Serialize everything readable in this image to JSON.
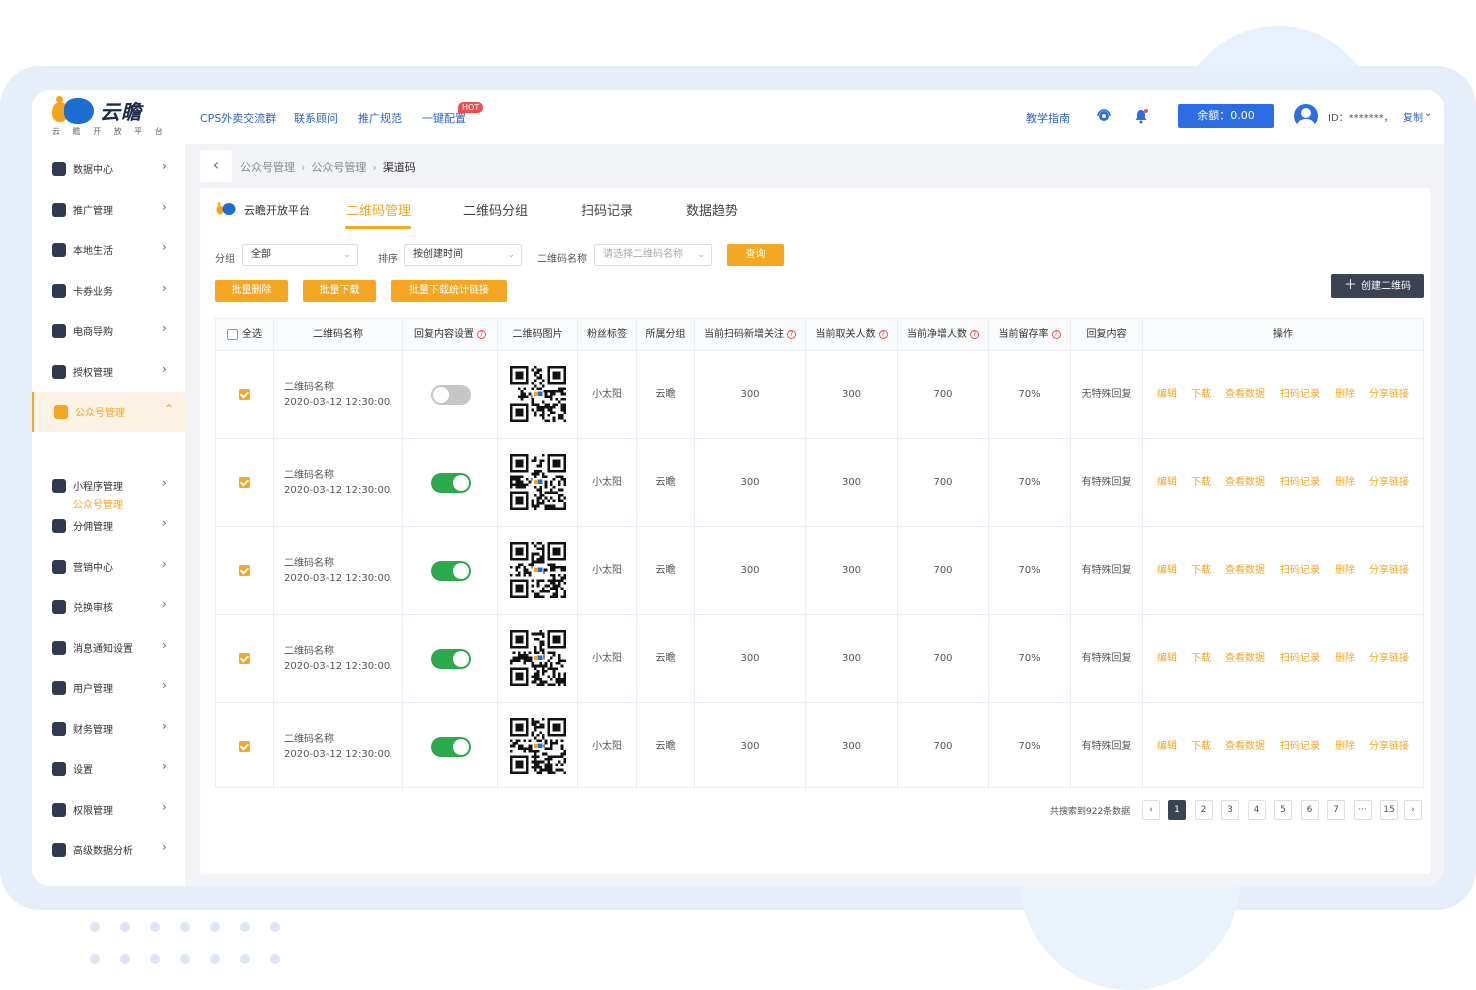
{
  "header": {
    "logo_text": "云瞻",
    "logo_sub": "云 瞻 开 放 平 台",
    "nav": [
      "CPS外卖交流群",
      "联系顾问",
      "推广规范",
      "一键配置"
    ],
    "hot_badge": "HOT",
    "guide": "教学指南",
    "balance": "余额：0.00",
    "user_id": "ID：*******，",
    "copy": "复制"
  },
  "sidebar": {
    "items": [
      {
        "label": "数据中心"
      },
      {
        "label": "推广管理"
      },
      {
        "label": "本地生活"
      },
      {
        "label": "卡券业务"
      },
      {
        "label": "电商导购"
      },
      {
        "label": "授权管理"
      },
      {
        "label": "公众号管理"
      },
      {
        "label": "小程序管理"
      },
      {
        "label": "分佣管理"
      },
      {
        "label": "营销中心"
      },
      {
        "label": "兑换审核"
      },
      {
        "label": "消息通知设置"
      },
      {
        "label": "用户管理"
      },
      {
        "label": "财务管理"
      },
      {
        "label": "设置"
      },
      {
        "label": "权限管理"
      },
      {
        "label": "高级数据分析"
      }
    ],
    "sub_item": "公众号管理"
  },
  "breadcrumb": [
    "公众号管理",
    "公众号管理",
    "渠道码"
  ],
  "tabs": {
    "brand": "云瞻开放平台",
    "items": [
      "二维码管理",
      "二维码分组",
      "扫码记录",
      "数据趋势"
    ]
  },
  "filters": {
    "group_label": "分组",
    "group_value": "全部",
    "sort_label": "排序",
    "sort_value": "按创建时间",
    "name_label": "二维码名称",
    "name_placeholder": "请选择二维码名称",
    "query": "查询"
  },
  "actions": {
    "batch_delete": "批量删除",
    "batch_download": "批量下载",
    "batch_download_links": "批量下载统计链接",
    "create": "创建二维码"
  },
  "table": {
    "headers": [
      "全选",
      "二维码名称",
      "回复内容设置",
      "二维码图片",
      "粉丝标签",
      "所属分组",
      "当前扫码新增关注",
      "当前取关人数",
      "当前净增人数",
      "当前留存率",
      "回复内容",
      "操作"
    ],
    "rows": [
      {
        "name": "二维码名称",
        "time": "2020-03-12 12:30:00",
        "switch_on": false,
        "tag": "小太阳",
        "group": "云瞻",
        "new": "300",
        "unfollow": "300",
        "net": "700",
        "rate": "70%",
        "reply": "无特殊回复"
      },
      {
        "name": "二维码名称",
        "time": "2020-03-12 12:30:00",
        "switch_on": true,
        "tag": "小太阳",
        "group": "云瞻",
        "new": "300",
        "unfollow": "300",
        "net": "700",
        "rate": "70%",
        "reply": "有特殊回复"
      },
      {
        "name": "二维码名称",
        "time": "2020-03-12 12:30:00",
        "switch_on": true,
        "tag": "小太阳",
        "group": "云瞻",
        "new": "300",
        "unfollow": "300",
        "net": "700",
        "rate": "70%",
        "reply": "有特殊回复"
      },
      {
        "name": "二维码名称",
        "time": "2020-03-12 12:30:00",
        "switch_on": true,
        "tag": "小太阳",
        "group": "云瞻",
        "new": "300",
        "unfollow": "300",
        "net": "700",
        "rate": "70%",
        "reply": "有特殊回复"
      },
      {
        "name": "二维码名称",
        "time": "2020-03-12 12:30:00",
        "switch_on": true,
        "tag": "小太阳",
        "group": "云瞻",
        "new": "300",
        "unfollow": "300",
        "net": "700",
        "rate": "70%",
        "reply": "有特殊回复"
      }
    ],
    "ops": [
      "编辑",
      "下载",
      "查看数据",
      "扫码记录",
      "删除",
      "分享链接"
    ]
  },
  "pagination": {
    "total": "共搜索到922条数据",
    "pages": [
      "1",
      "2",
      "3",
      "4",
      "5",
      "6",
      "7",
      "···",
      "15"
    ],
    "current": "1"
  },
  "colors": {
    "accent": "#f5a623",
    "primary": "#2d6de4",
    "switch_on": "#2ea84d",
    "dark_button": "#3b4252"
  }
}
